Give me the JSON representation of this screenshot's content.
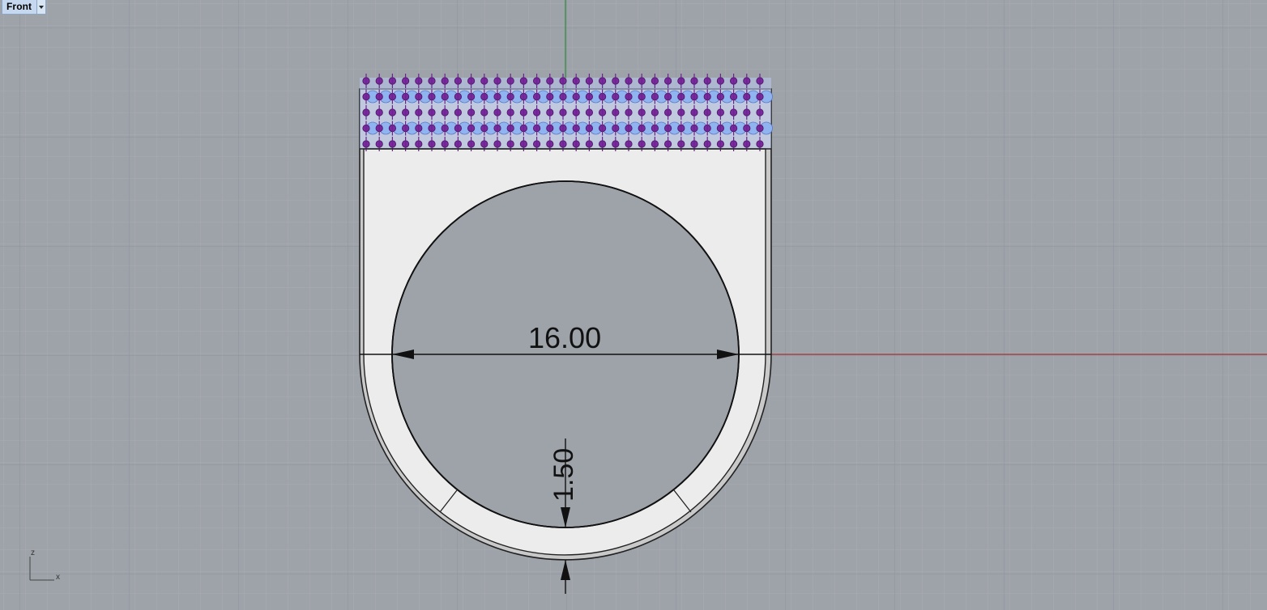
{
  "viewport": {
    "name": "Front"
  },
  "dimensions": {
    "diameter": "16.00",
    "thickness": "1.50"
  },
  "axis_indicator": {
    "vertical": "z",
    "horizontal": "x"
  },
  "colors": {
    "background": "#9ea3aa",
    "grid_minor": "#a8acb2",
    "grid_major": "#8c9097",
    "x_axis": "#a03030",
    "y_axis": "#2e8b3a",
    "ring_body": "#ececec",
    "stone_purple": "#7a2a9c",
    "stone_blue": "#8fb4f0"
  },
  "icons": {
    "dropdown": "chevron-down-icon",
    "axis": "axis-triad-icon"
  }
}
